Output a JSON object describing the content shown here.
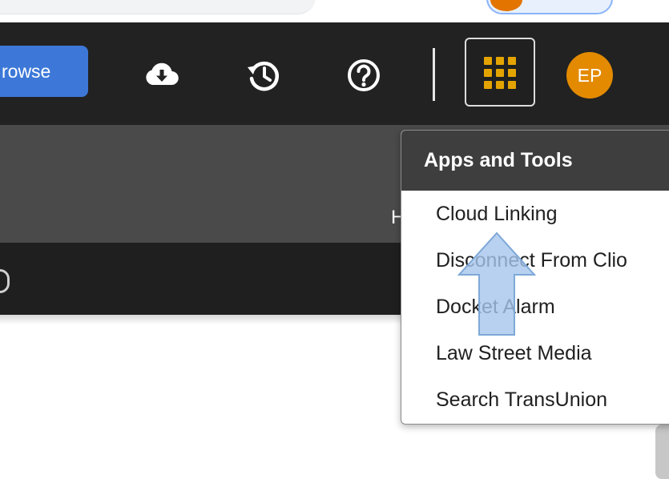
{
  "toolbar": {
    "browse_label": "rowse",
    "icons": [
      "cloud-download-icon",
      "history-icon",
      "help-icon",
      "apps-grid-icon"
    ],
    "accent_color": "#3d78d8",
    "apps_icon_color": "#e4a400"
  },
  "user": {
    "initials": "EP",
    "avatar_color": "#e38a00"
  },
  "page": {
    "partial_text": "H"
  },
  "apps_menu": {
    "header": "Apps and Tools",
    "items": [
      {
        "label": "Cloud Linking"
      },
      {
        "label": "Disconnect From Clio"
      },
      {
        "label": "Docket Alarm"
      },
      {
        "label": "Law Street Media"
      },
      {
        "label": "Search TransUnion"
      }
    ]
  },
  "annotation": {
    "type": "up-arrow",
    "color": "#9fc2ea",
    "points_to": "Cloud Linking"
  }
}
